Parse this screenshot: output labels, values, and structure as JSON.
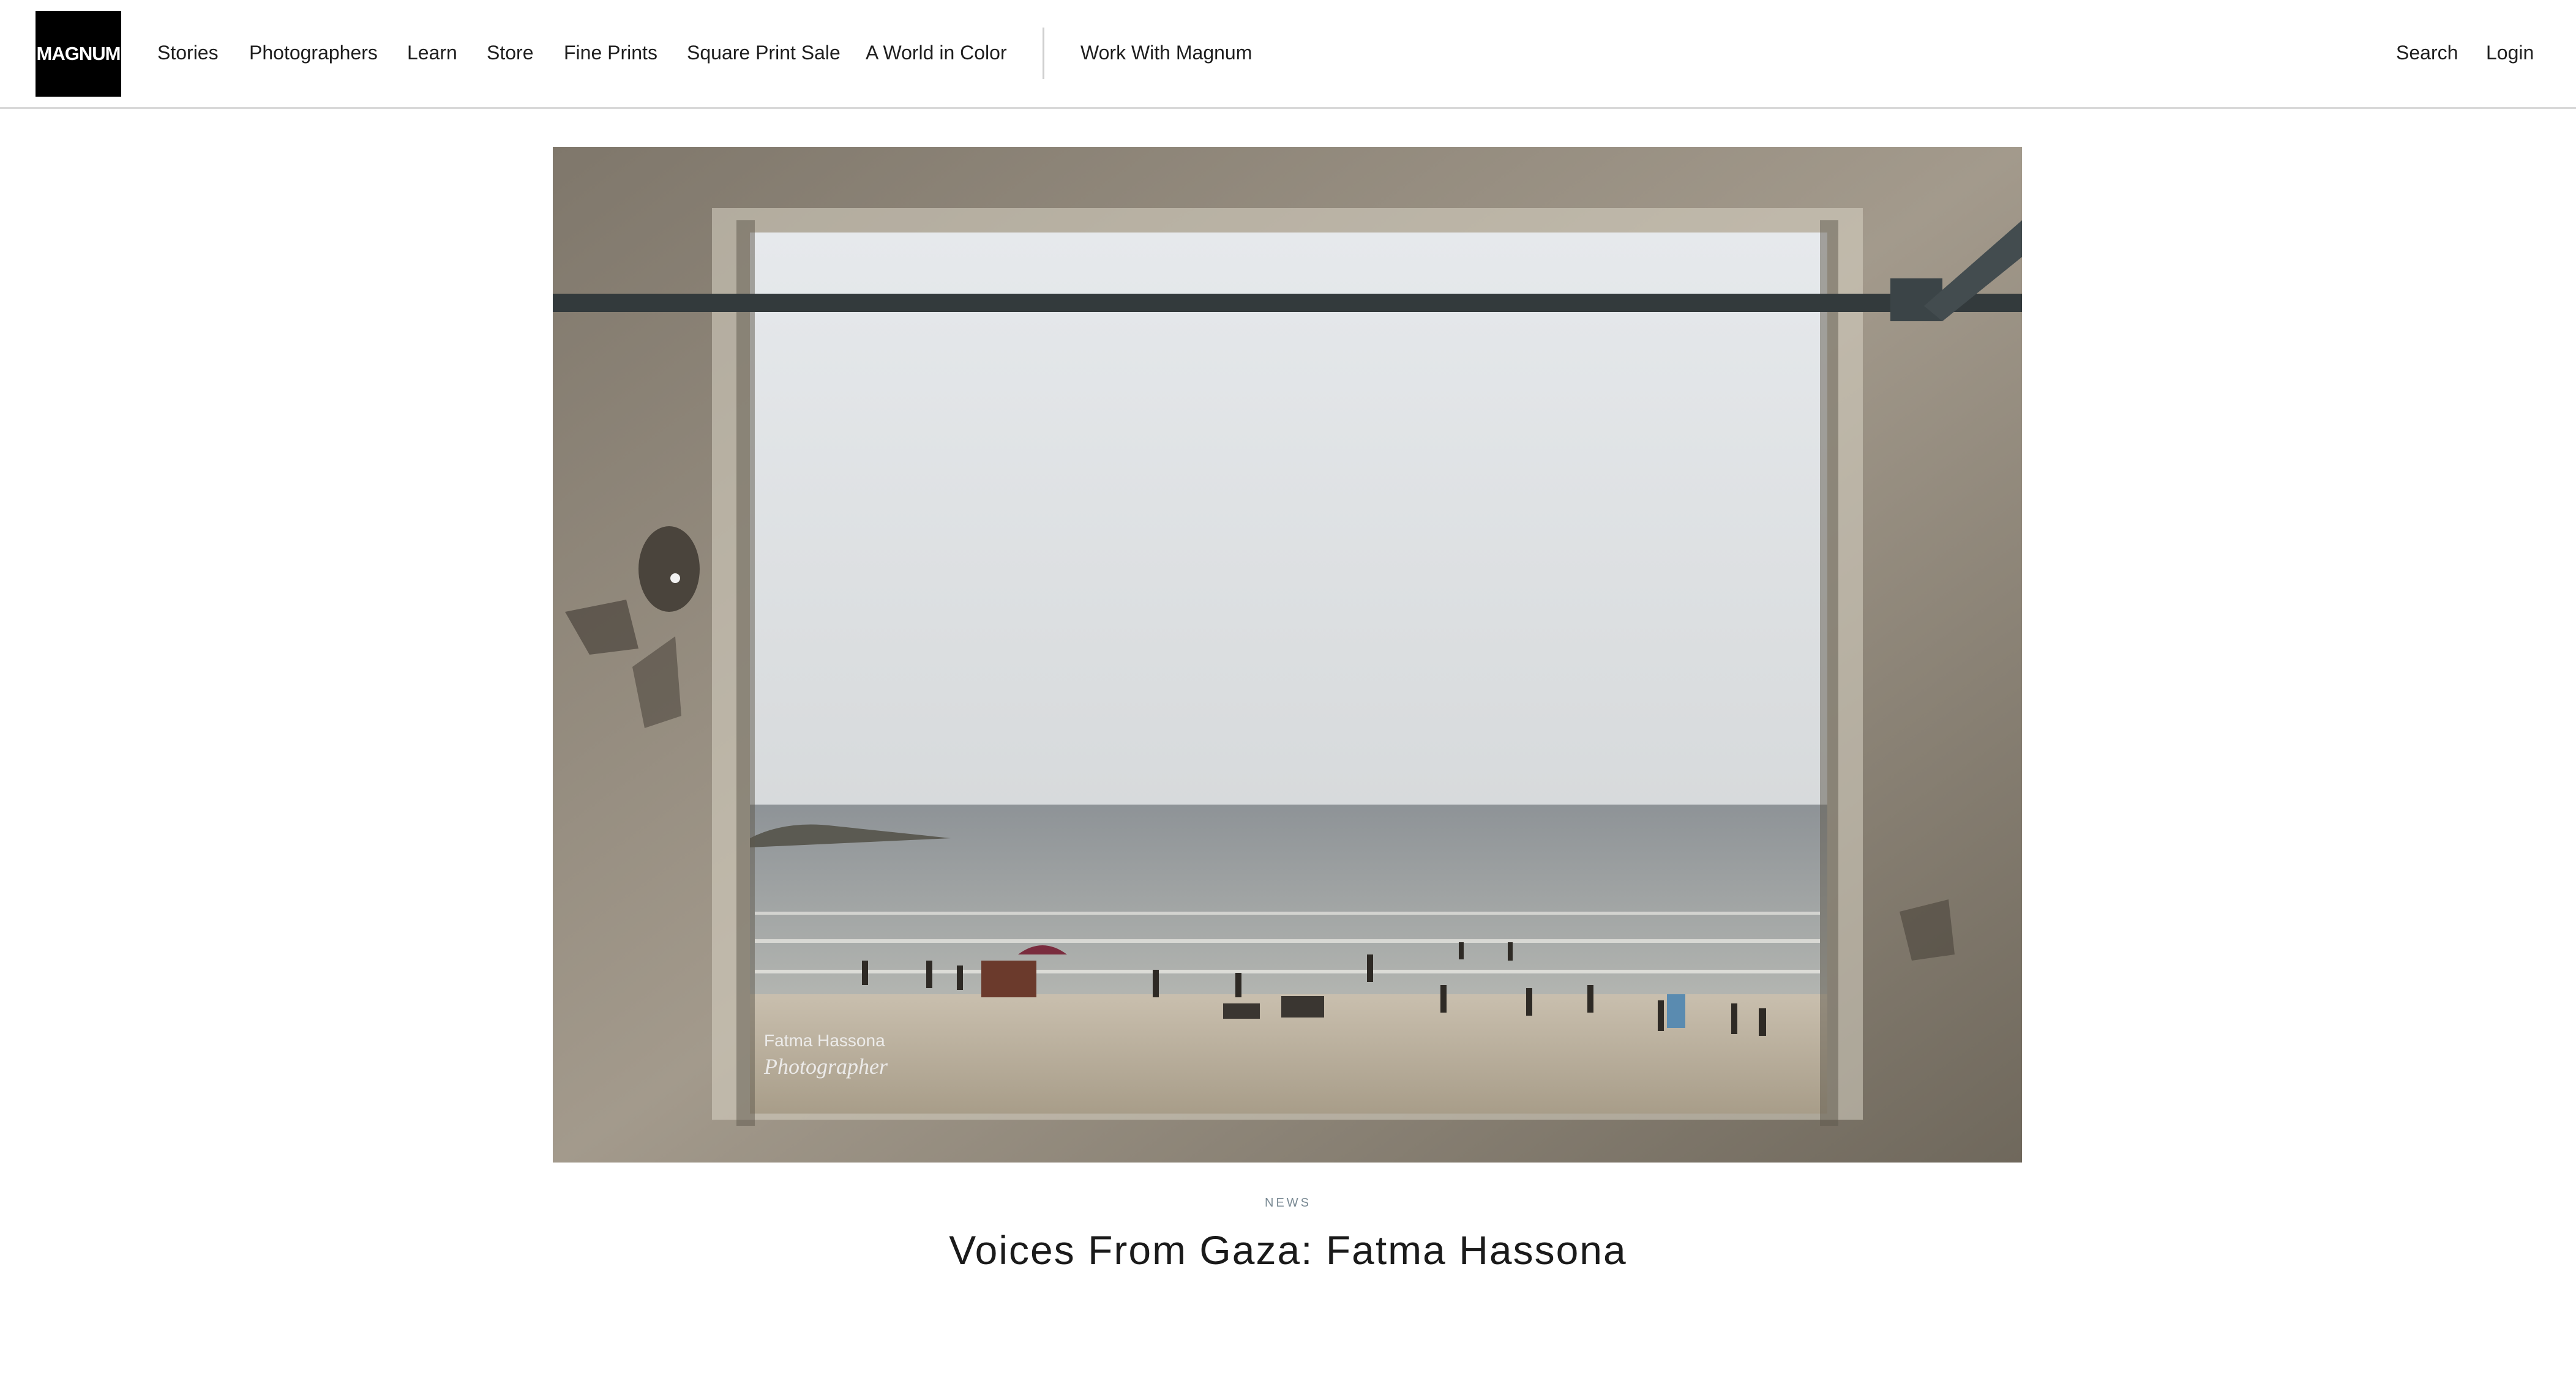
{
  "header": {
    "logo_text": "MAGNUM",
    "nav": [
      {
        "label": "Stories"
      },
      {
        "label": "Photographers"
      },
      {
        "label": "Learn"
      },
      {
        "label": "Store"
      },
      {
        "label": "Fine Prints"
      },
      {
        "label": "Square Print Sale"
      },
      {
        "label": "A World in Color"
      }
    ],
    "work_with": "Work With Magnum",
    "search": "Search",
    "login": "Login"
  },
  "hero": {
    "watermark_name": "Fatma Hassona",
    "watermark_sub": "Photographer"
  },
  "article": {
    "category": "NEWS",
    "title": "Voices From Gaza: Fatma Hassona"
  }
}
